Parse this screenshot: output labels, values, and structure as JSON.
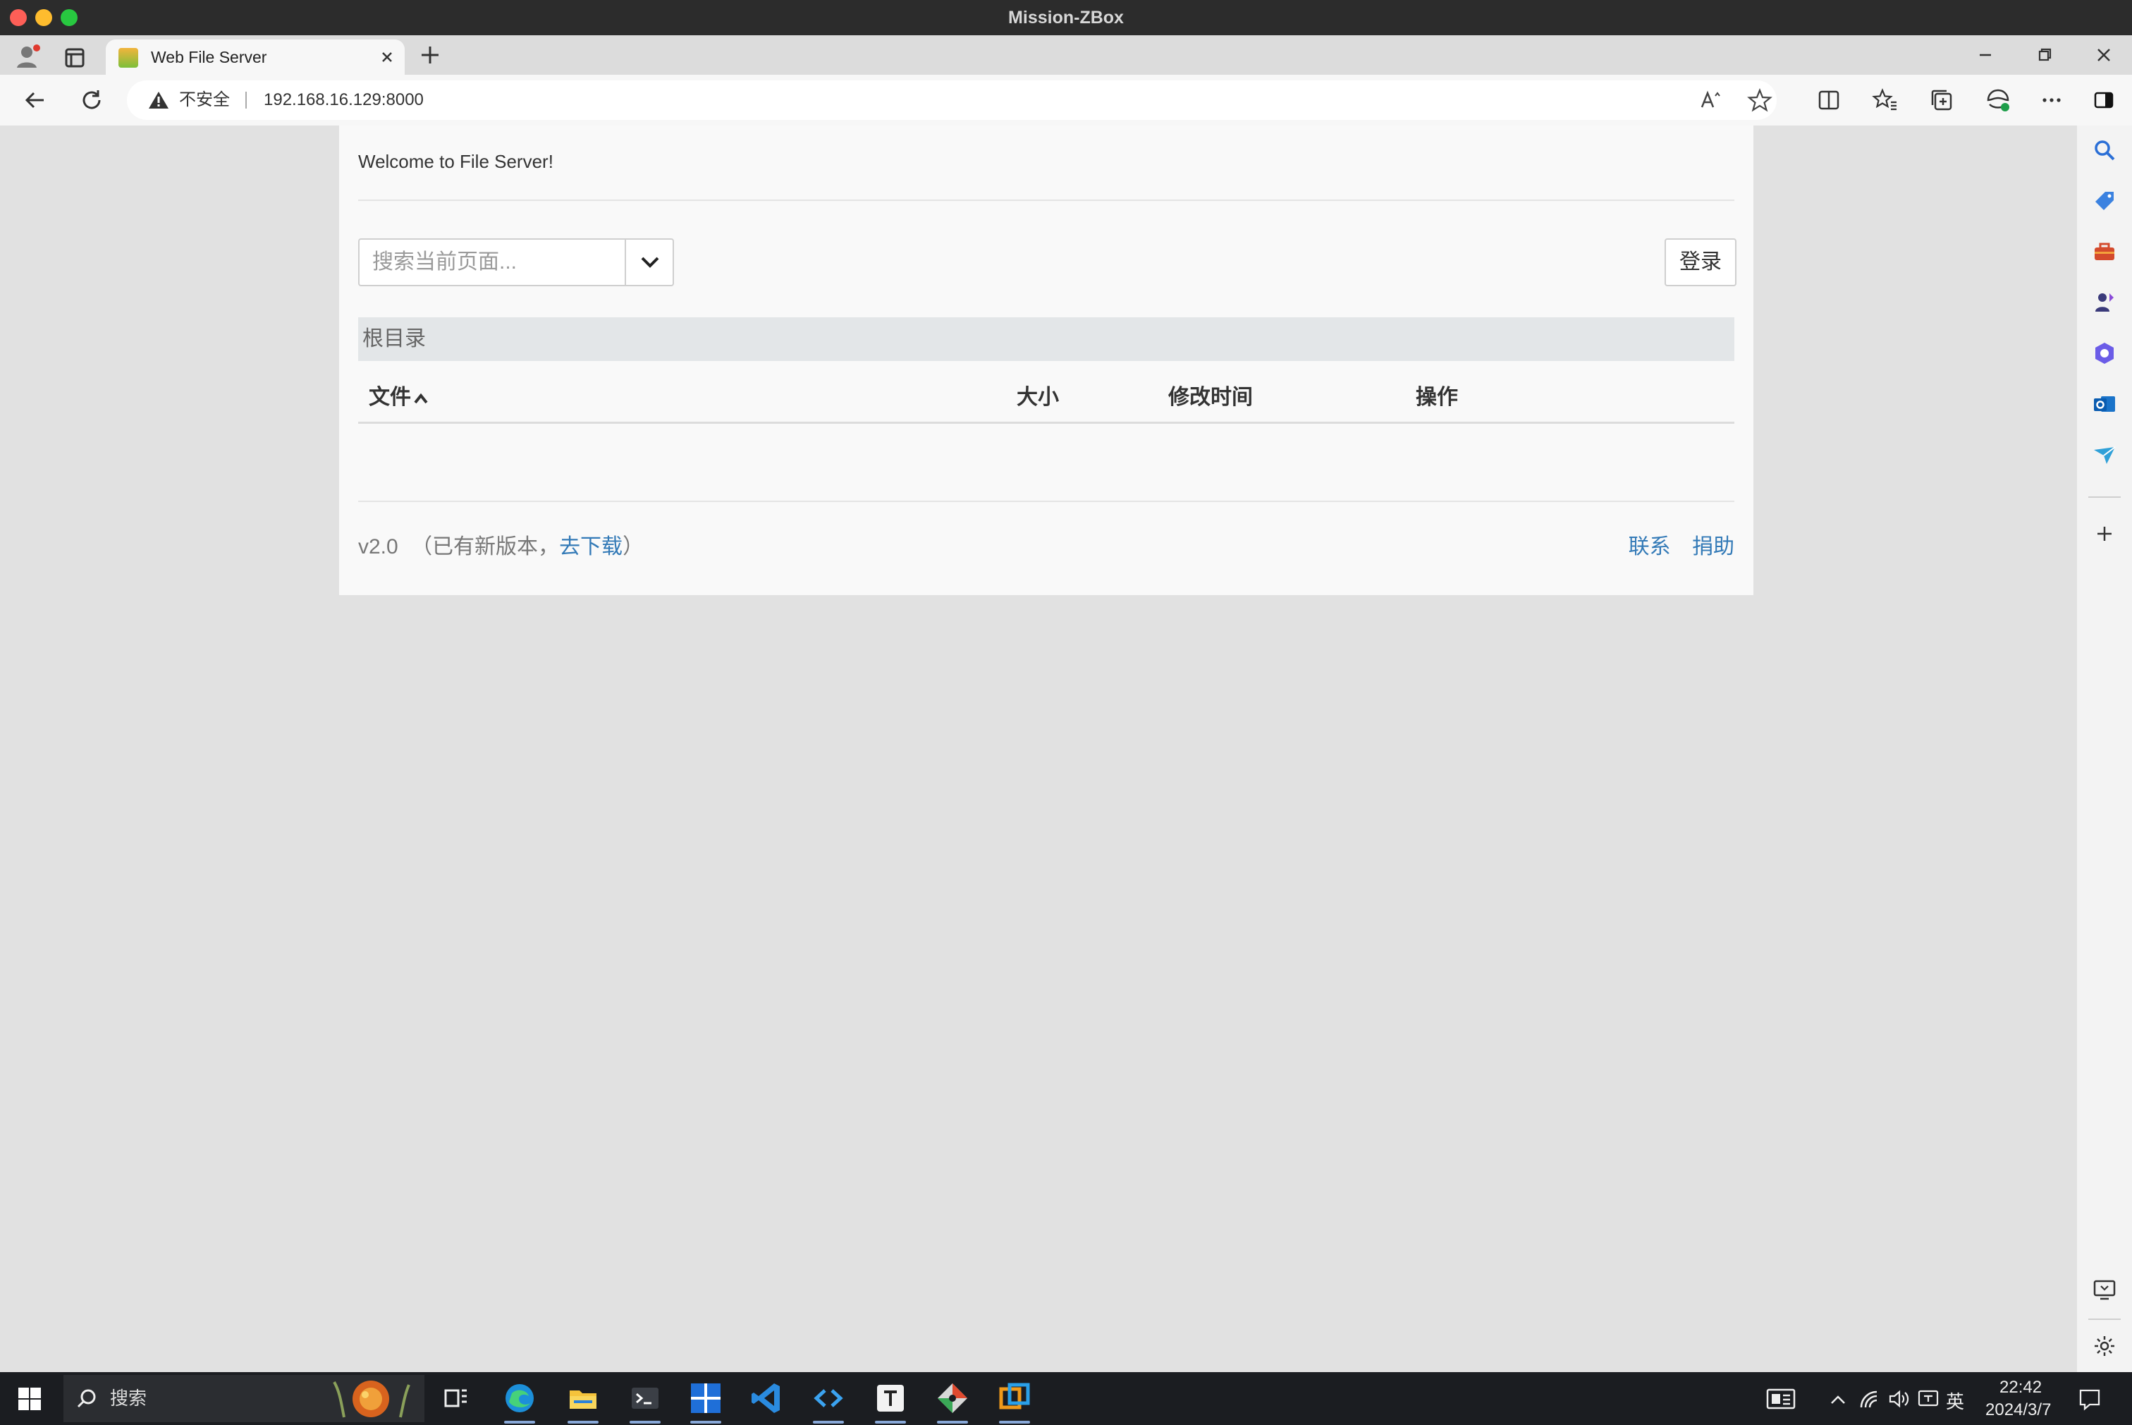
{
  "window": {
    "title": "Mission-ZBox"
  },
  "browser": {
    "tab_title": "Web File Server",
    "security_label": "不安全",
    "url": "192.168.16.129:8000"
  },
  "page": {
    "welcome": "Welcome to File Server!",
    "search_placeholder": "搜索当前页面...",
    "login_label": "登录",
    "breadcrumb": "根目录",
    "columns": {
      "file": "文件",
      "size": "大小",
      "modified": "修改时间",
      "actions": "操作"
    },
    "footer": {
      "version": "v2.0",
      "update_prefix": "（已有新版本，",
      "update_link": "去下载",
      "update_suffix": "）",
      "contact": "联系",
      "donate": "捐助"
    }
  },
  "taskbar": {
    "search_label": "搜索",
    "ime_label": "英",
    "time": "22:42",
    "date": "2024/3/7"
  },
  "colors": {
    "link": "#337ab7",
    "breadcrumb_bg": "#e3e6e8",
    "taskbar_bg": "#1b1d21"
  }
}
